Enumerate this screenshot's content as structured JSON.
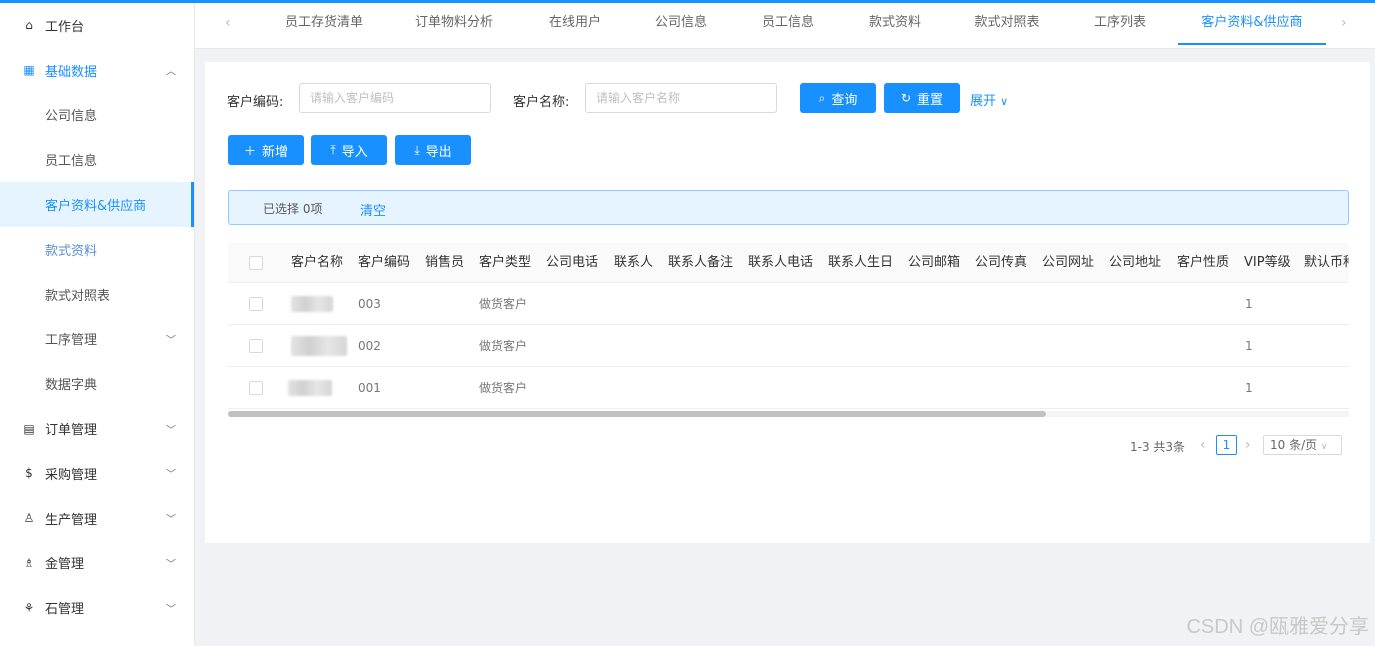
{
  "sidebar": {
    "items": [
      {
        "label": "工作台",
        "icon": "home-icon"
      },
      {
        "label": "基础数据",
        "icon": "grid-icon",
        "open": true
      },
      {
        "label": "公司信息"
      },
      {
        "label": "员工信息"
      },
      {
        "label": "客户资料&供应商",
        "active": true
      },
      {
        "label": "款式资料"
      },
      {
        "label": "款式对照表"
      },
      {
        "label": "工序管理",
        "expandable": true
      },
      {
        "label": "数据字典"
      },
      {
        "label": "订单管理",
        "icon": "order-icon",
        "expandable": true
      },
      {
        "label": "采购管理",
        "icon": "purchase-icon",
        "expandable": true
      },
      {
        "label": "生产管理",
        "icon": "production-icon",
        "expandable": true
      },
      {
        "label": "金管理",
        "icon": "gold-icon",
        "expandable": true
      },
      {
        "label": "石管理",
        "icon": "stone-icon",
        "expandable": true
      }
    ]
  },
  "tabs": [
    {
      "label": "员工存货清单"
    },
    {
      "label": "订单物料分析"
    },
    {
      "label": "在线用户"
    },
    {
      "label": "公司信息"
    },
    {
      "label": "员工信息"
    },
    {
      "label": "款式资料"
    },
    {
      "label": "款式对照表"
    },
    {
      "label": "工序列表"
    },
    {
      "label": "客户资料&供应商",
      "active": true
    }
  ],
  "filters": {
    "code_label": "客户编码:",
    "code_placeholder": "请输入客户编码",
    "name_label": "客户名称:",
    "name_placeholder": "请输入客户名称",
    "search_label": "查询",
    "reset_label": "重置",
    "expand_label": "展开"
  },
  "actions": {
    "add_label": "新增",
    "import_label": "导入",
    "export_label": "导出"
  },
  "selection": {
    "text_prefix": "已选择 ",
    "count": "0",
    "text_suffix": "项",
    "clear_label": "清空"
  },
  "table": {
    "columns": [
      "客户名称",
      "客户编码",
      "销售员",
      "客户类型",
      "公司电话",
      "联系人",
      "联系人备注",
      "联系人电话",
      "联系人生日",
      "公司邮箱",
      "公司传真",
      "公司网址",
      "公司地址",
      "客户性质",
      "VIP等级",
      "默认币种"
    ],
    "rows": [
      {
        "code": "003",
        "type": "做货客户",
        "vip": "1"
      },
      {
        "code": "002",
        "type": "做货客户",
        "vip": "1"
      },
      {
        "code": "001",
        "type": "做货客户",
        "vip": "1"
      }
    ]
  },
  "pagination": {
    "summary": "1-3 共3条",
    "current_page": "1",
    "page_size": "10 条/页"
  },
  "watermark": "CSDN @瓯雅爱分享",
  "colors": {
    "primary": "#1890ff",
    "selection_bg": "#e6f4ff"
  }
}
